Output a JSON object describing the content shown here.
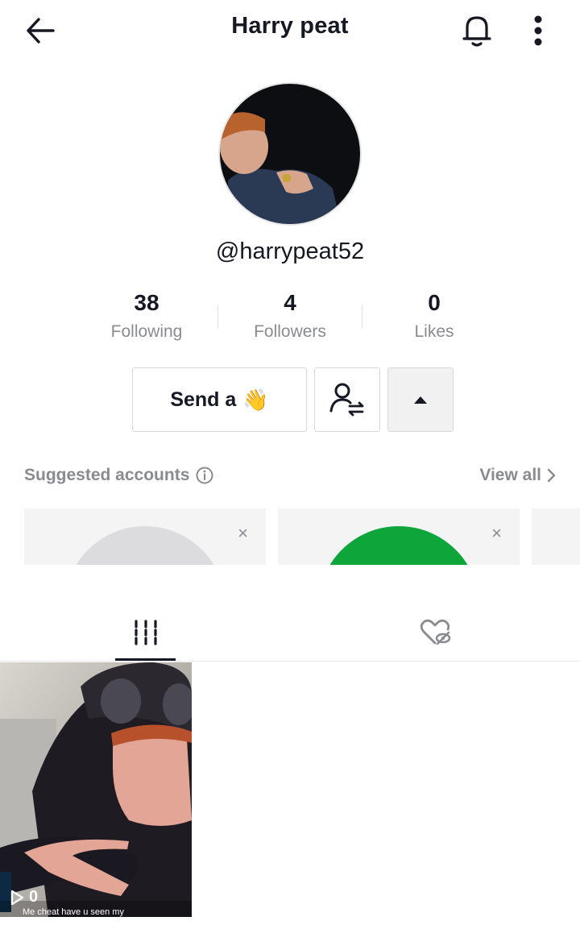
{
  "header": {
    "title": "Harry peat"
  },
  "profile": {
    "username": "@harrypeat52"
  },
  "stats": [
    {
      "value": "38",
      "label": "Following"
    },
    {
      "value": "4",
      "label": "Followers"
    },
    {
      "value": "0",
      "label": "Likes"
    }
  ],
  "actions": {
    "send_label": "Send a",
    "send_emoji": "👋"
  },
  "suggested": {
    "title": "Suggested accounts",
    "view_all": "View all",
    "cards": [
      {
        "close": "×",
        "avatar_color": "#dcdcde"
      },
      {
        "close": "×",
        "avatar_color": "#0ea63a"
      }
    ]
  },
  "video": {
    "views": "0",
    "caption": "Me cheat have u seen my"
  },
  "colors": {
    "text": "#161823",
    "muted": "#8a8b91",
    "divider": "#e8e8e8"
  }
}
